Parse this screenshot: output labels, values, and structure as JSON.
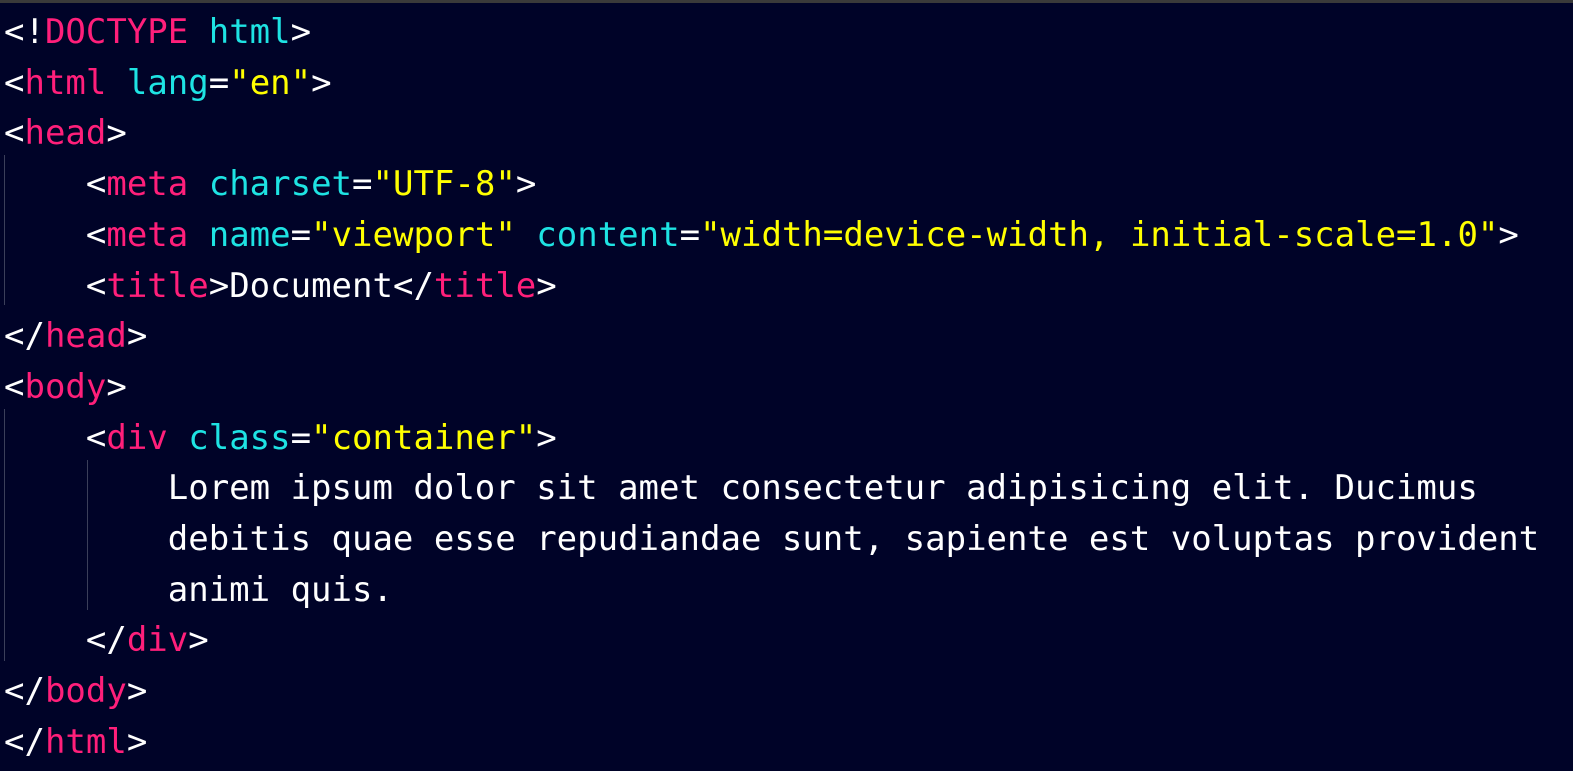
{
  "editor": {
    "background": "#000328",
    "colors": {
      "punctuation": "#ffffff",
      "tag": "#ff1f7a",
      "attribute": "#1ee3e3",
      "string": "#ffff00",
      "text": "#ffffff"
    },
    "lines": [
      [
        {
          "k": "p",
          "v": "<!"
        },
        {
          "k": "t",
          "v": "DOCTYPE"
        },
        {
          "k": "p",
          "v": " "
        },
        {
          "k": "a",
          "v": "html"
        },
        {
          "k": "p",
          "v": ">"
        }
      ],
      [
        {
          "k": "p",
          "v": "<"
        },
        {
          "k": "t",
          "v": "html"
        },
        {
          "k": "p",
          "v": " "
        },
        {
          "k": "a",
          "v": "lang"
        },
        {
          "k": "p",
          "v": "="
        },
        {
          "k": "s",
          "v": "\"en\""
        },
        {
          "k": "p",
          "v": ">"
        }
      ],
      [
        {
          "k": "p",
          "v": "<"
        },
        {
          "k": "t",
          "v": "head"
        },
        {
          "k": "p",
          "v": ">"
        }
      ],
      [
        {
          "k": "p",
          "v": "    <"
        },
        {
          "k": "t",
          "v": "meta"
        },
        {
          "k": "p",
          "v": " "
        },
        {
          "k": "a",
          "v": "charset"
        },
        {
          "k": "p",
          "v": "="
        },
        {
          "k": "s",
          "v": "\"UTF-8\""
        },
        {
          "k": "p",
          "v": ">"
        }
      ],
      [
        {
          "k": "p",
          "v": "    <"
        },
        {
          "k": "t",
          "v": "meta"
        },
        {
          "k": "p",
          "v": " "
        },
        {
          "k": "a",
          "v": "name"
        },
        {
          "k": "p",
          "v": "="
        },
        {
          "k": "s",
          "v": "\"viewport\""
        },
        {
          "k": "p",
          "v": " "
        },
        {
          "k": "a",
          "v": "content"
        },
        {
          "k": "p",
          "v": "="
        },
        {
          "k": "s",
          "v": "\"width=device-width, initial-scale=1.0\""
        },
        {
          "k": "p",
          "v": ">"
        }
      ],
      [
        {
          "k": "p",
          "v": "    <"
        },
        {
          "k": "t",
          "v": "title"
        },
        {
          "k": "p",
          "v": ">"
        },
        {
          "k": "x",
          "v": "Document"
        },
        {
          "k": "p",
          "v": "</"
        },
        {
          "k": "t",
          "v": "title"
        },
        {
          "k": "p",
          "v": ">"
        }
      ],
      [
        {
          "k": "p",
          "v": "</"
        },
        {
          "k": "t",
          "v": "head"
        },
        {
          "k": "p",
          "v": ">"
        }
      ],
      [
        {
          "k": "p",
          "v": "<"
        },
        {
          "k": "t",
          "v": "body"
        },
        {
          "k": "p",
          "v": ">"
        }
      ],
      [
        {
          "k": "p",
          "v": "    <"
        },
        {
          "k": "t",
          "v": "div"
        },
        {
          "k": "p",
          "v": " "
        },
        {
          "k": "a",
          "v": "class"
        },
        {
          "k": "p",
          "v": "="
        },
        {
          "k": "s",
          "v": "\"container\""
        },
        {
          "k": "p",
          "v": ">"
        }
      ],
      [
        {
          "k": "x",
          "v": "        Lorem ipsum dolor sit amet consectetur adipisicing elit. Ducimus"
        }
      ],
      [
        {
          "k": "x",
          "v": "        debitis quae esse repudiandae sunt, sapiente est voluptas provident"
        }
      ],
      [
        {
          "k": "x",
          "v": "        animi quis."
        }
      ],
      [
        {
          "k": "p",
          "v": "    </"
        },
        {
          "k": "t",
          "v": "div"
        },
        {
          "k": "p",
          "v": ">"
        }
      ],
      [
        {
          "k": "p",
          "v": "</"
        },
        {
          "k": "t",
          "v": "body"
        },
        {
          "k": "p",
          "v": ">"
        }
      ],
      [
        {
          "k": "p",
          "v": "</"
        },
        {
          "k": "t",
          "v": "html"
        },
        {
          "k": "p",
          "v": ">"
        }
      ]
    ]
  }
}
